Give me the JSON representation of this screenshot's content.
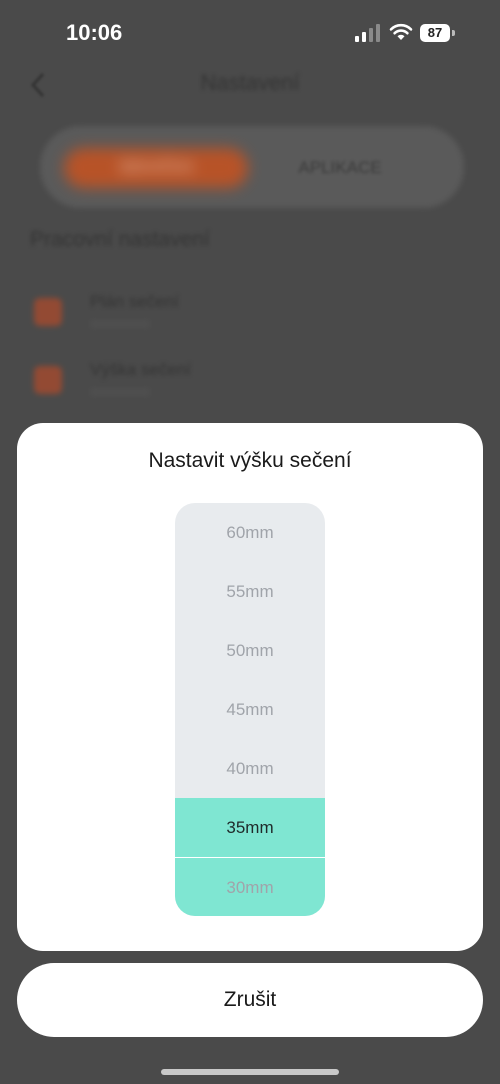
{
  "status_bar": {
    "time": "10:06",
    "battery": "87"
  },
  "background_page": {
    "title": "Nastavení",
    "tabs": [
      "SEKAČKA",
      "APLIKACE"
    ],
    "section_title": "Pracovní nastavení",
    "rows": [
      {
        "label": "Plán sečení",
        "icon": "calendar-icon"
      },
      {
        "label": "Výška sečení",
        "icon": "height-icon"
      }
    ],
    "accent_color": "#c8521f"
  },
  "sheet": {
    "title": "Nastavit výšku sečení",
    "options": [
      "60mm",
      "55mm",
      "50mm",
      "45mm",
      "40mm",
      "35mm",
      "30mm"
    ],
    "selected": "35mm",
    "selection_color": "#7fe6d2"
  },
  "cancel_label": "Zrušit"
}
